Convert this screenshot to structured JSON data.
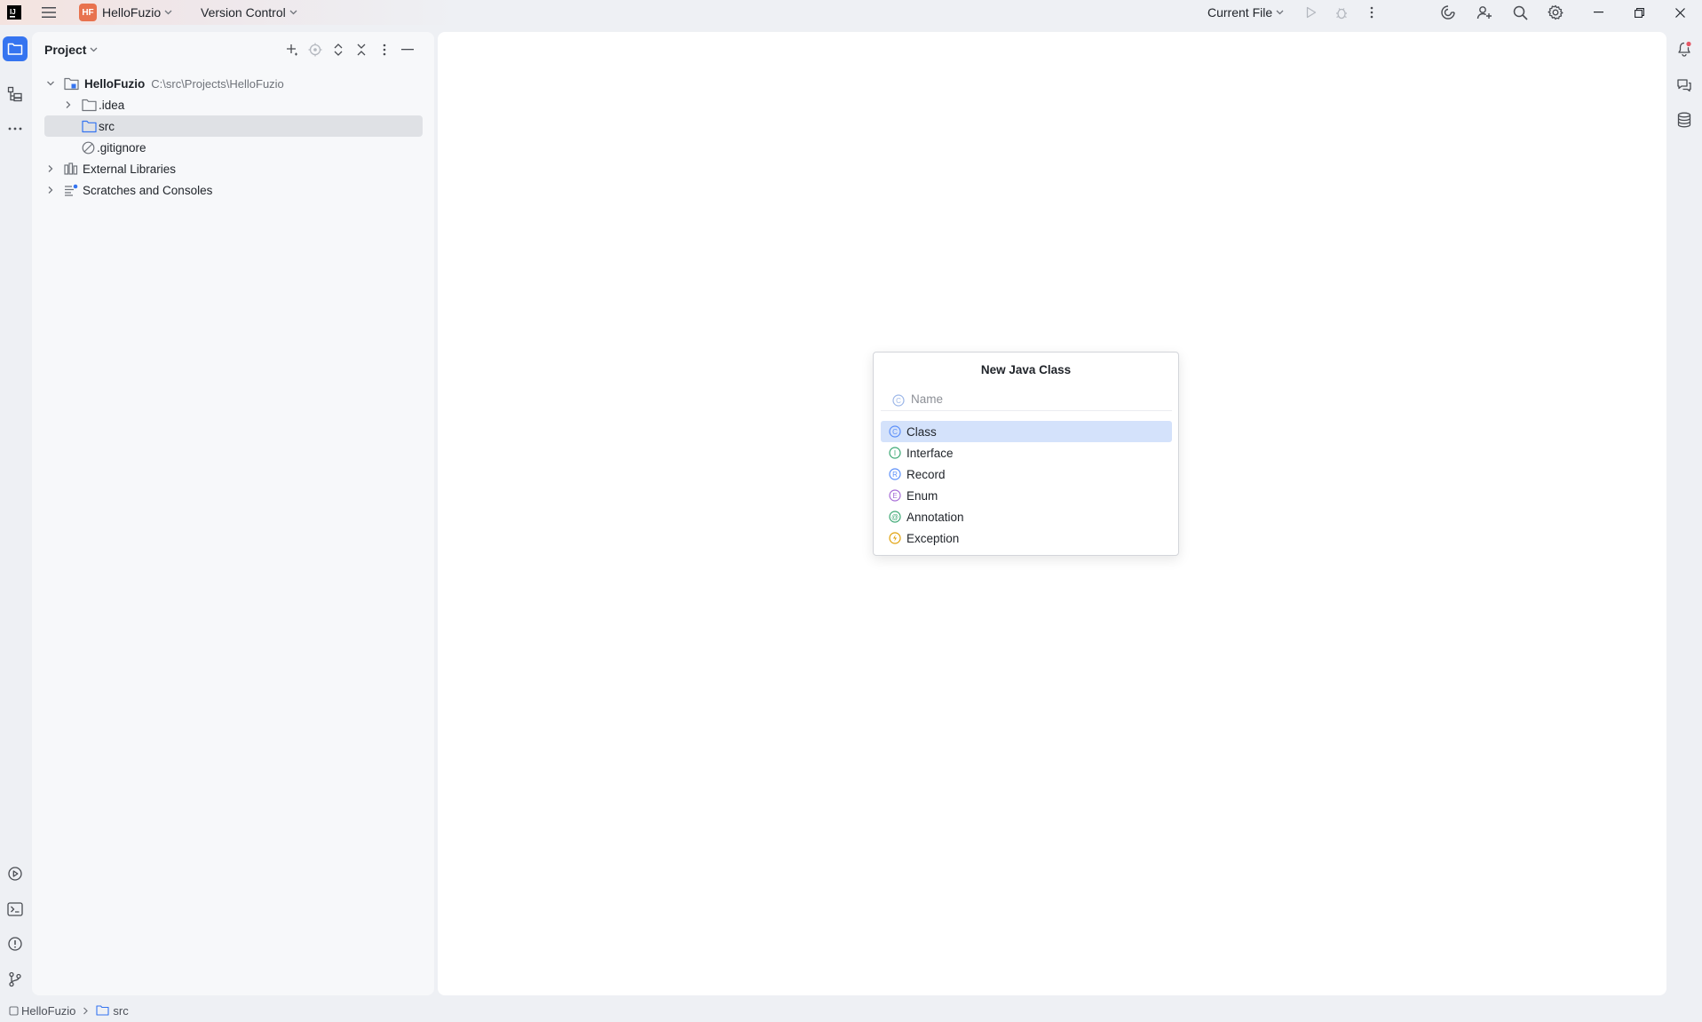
{
  "titlebar": {
    "project_badge": "HF",
    "project_name": "HelloFuzio",
    "vcs_label": "Version Control",
    "run_config": "Current File"
  },
  "project_panel": {
    "title": "Project",
    "tree": [
      {
        "name": "HelloFuzio",
        "path": "C:\\src\\Projects\\HelloFuzio"
      },
      {
        "name": ".idea"
      },
      {
        "name": "src"
      },
      {
        "name": ".gitignore"
      },
      {
        "name": "External Libraries"
      },
      {
        "name": "Scratches and Consoles"
      }
    ]
  },
  "popup": {
    "title": "New Java Class",
    "placeholder": "Name",
    "kinds": [
      {
        "label": "Class",
        "letter": "C",
        "color": "#5b8ff9"
      },
      {
        "label": "Interface",
        "letter": "I",
        "color": "#3ca874"
      },
      {
        "label": "Record",
        "letter": "R",
        "color": "#5b8ff9"
      },
      {
        "label": "Enum",
        "letter": "E",
        "color": "#a66bd6"
      },
      {
        "label": "Annotation",
        "letter": "@",
        "color": "#3ca874"
      },
      {
        "label": "Exception",
        "letter": "⚡",
        "color": "#e0a008"
      }
    ]
  },
  "statusbar": {
    "crumb_project": "HelloFuzio",
    "crumb_folder": "src"
  },
  "colors": {
    "accent": "#3574f0",
    "badge": "#e8724e",
    "notification_dot": "#e55765"
  }
}
